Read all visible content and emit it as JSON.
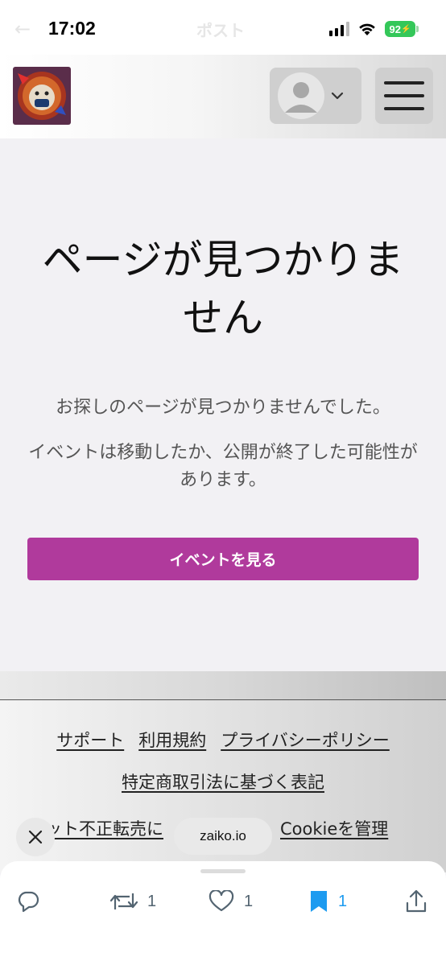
{
  "status_bar": {
    "time": "17:02",
    "battery": "92",
    "ghost_back": "←",
    "ghost_title": "ポスト"
  },
  "header": {
    "logo_icon": "lion-logo-icon",
    "account_icon": "user-avatar-icon",
    "dropdown_icon": "chevron-down-icon",
    "menu_icon": "hamburger-menu-icon"
  },
  "main": {
    "title": "ページが見つかりません",
    "message_1": "お探しのページが見つかりませんでした。",
    "message_2": "イベントは移動したか、公開が終了した可能性があります。",
    "cta_label": "イベントを見る",
    "accent_color": "#b03a9c"
  },
  "footer": {
    "links": [
      "サポート",
      "利用規約",
      "プライバシーポリシー"
    ],
    "legal_link": "特定商取引法に基づく表記",
    "partial_link": "ット不正転売に",
    "cookie_link": "Cookieを管理"
  },
  "overlay": {
    "close_icon": "close-icon",
    "domain": "zaiko.io"
  },
  "actions": {
    "reply_count": "",
    "repost_count": "1",
    "like_count": "1",
    "bookmark_count": "1",
    "bookmark_color": "#1d9bf0"
  }
}
